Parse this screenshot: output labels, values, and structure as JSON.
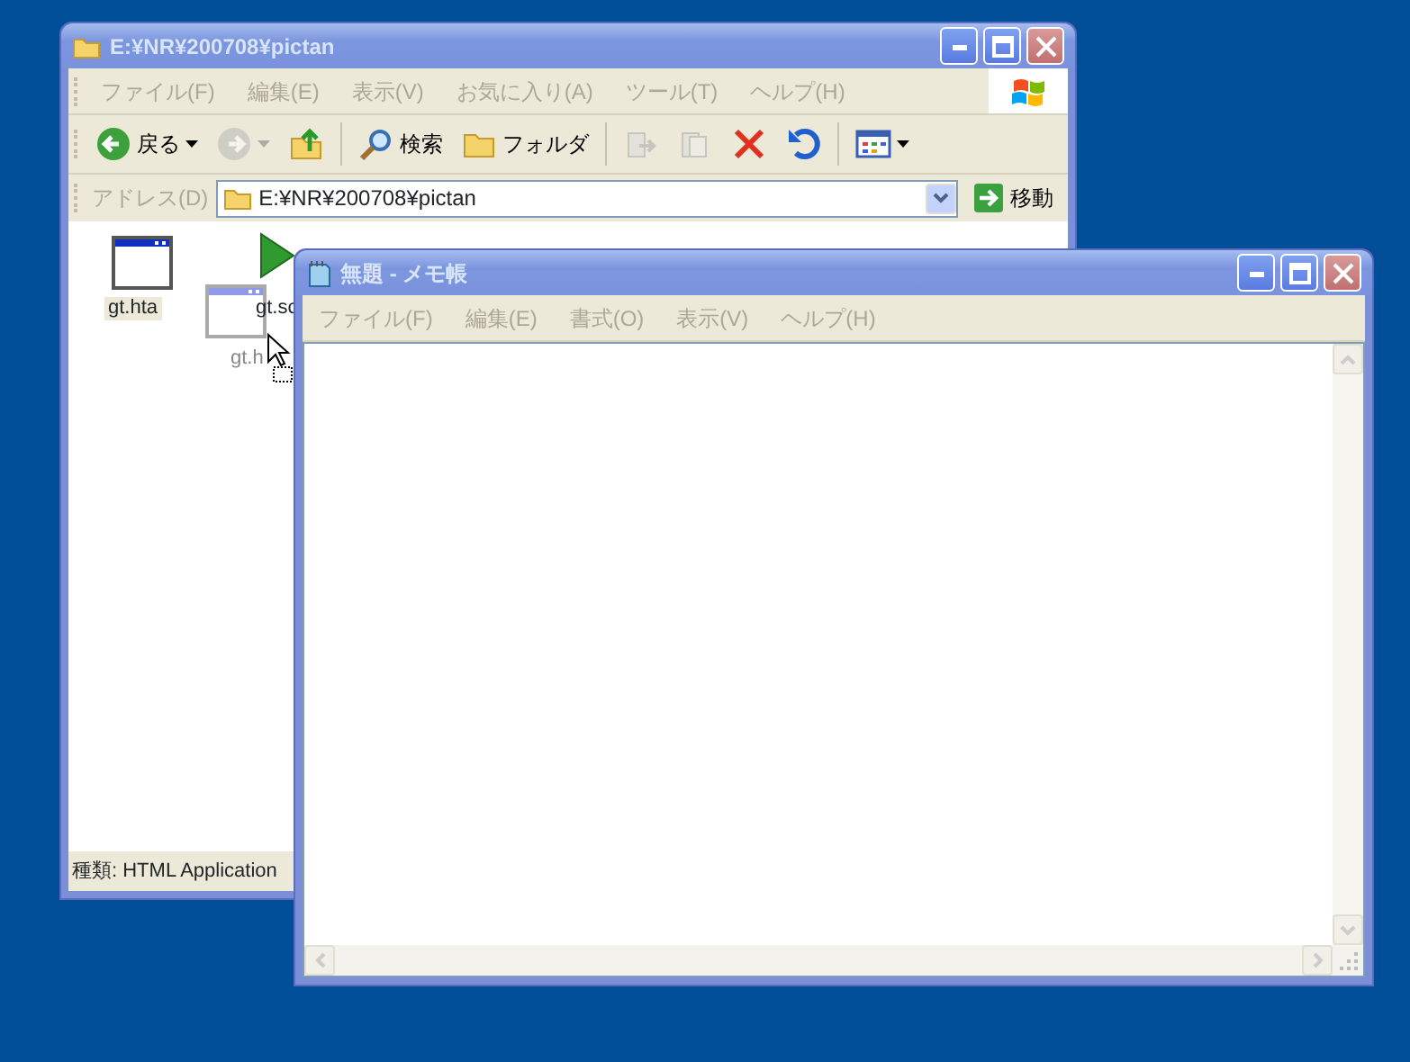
{
  "explorer": {
    "title": "E:¥NR¥200708¥pictan",
    "menu": [
      {
        "label": "ファイル(F)",
        "disabled": true
      },
      {
        "label": "編集(E)",
        "disabled": true
      },
      {
        "label": "表示(V)",
        "disabled": true
      },
      {
        "label": "お気に入り(A)",
        "disabled": true
      },
      {
        "label": "ツール(T)",
        "disabled": true
      },
      {
        "label": "ヘルプ(H)",
        "disabled": true
      }
    ],
    "toolbar": [
      {
        "kind": "back",
        "label": "戻る",
        "disabled": false
      },
      {
        "kind": "forward",
        "disabled": true
      },
      {
        "kind": "up",
        "disabled": false
      },
      {
        "kind": "sep"
      },
      {
        "kind": "search",
        "label": "検索",
        "disabled": false
      },
      {
        "kind": "folders",
        "label": "フォルダ",
        "disabled": false
      },
      {
        "kind": "sep"
      },
      {
        "kind": "moveto",
        "disabled": true
      },
      {
        "kind": "copyto",
        "disabled": true
      },
      {
        "kind": "delete",
        "disabled": false
      },
      {
        "kind": "undo",
        "disabled": false
      },
      {
        "kind": "sep"
      },
      {
        "kind": "views",
        "disabled": false
      }
    ],
    "address": {
      "label": "アドレス(D)",
      "value": "E:¥NR¥200708¥pictan",
      "go": "移動"
    },
    "files": [
      {
        "label": "gt.hta",
        "selected": true
      },
      {
        "label": "gt.sc",
        "selected": false
      }
    ],
    "drag_ghost": {
      "label": "gt.h"
    },
    "status_bar": "種類: HTML Application"
  },
  "notepad": {
    "title": "無題 - メモ帳",
    "menu": [
      {
        "label": "ファイル(F)",
        "disabled": true
      },
      {
        "label": "編集(E)",
        "disabled": true
      },
      {
        "label": "書式(O)",
        "disabled": true
      },
      {
        "label": "表示(V)",
        "disabled": true
      },
      {
        "label": "ヘルプ(H)",
        "disabled": true
      }
    ]
  }
}
